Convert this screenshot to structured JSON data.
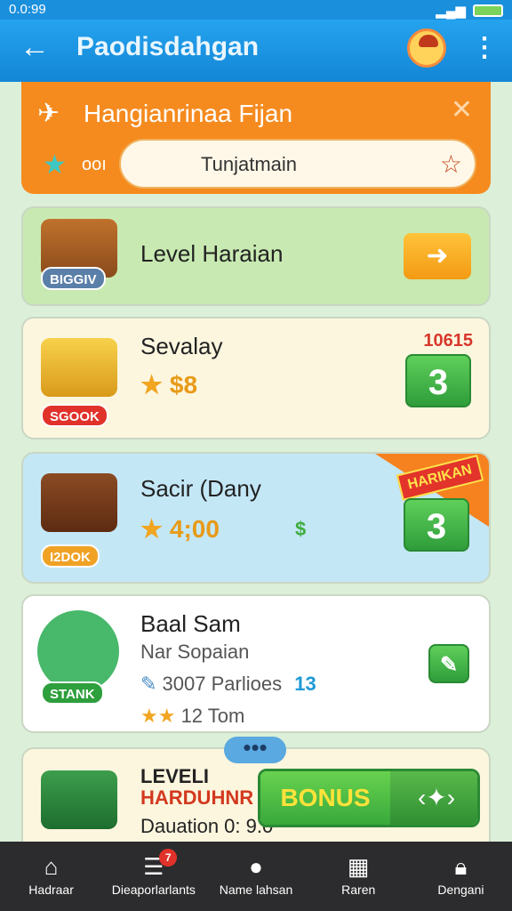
{
  "status_bar": {
    "time": "0.0:99"
  },
  "app_bar": {
    "title": "Paodisdahgan",
    "back_icon": "arrow-left-icon",
    "menu_icon": "more-vert-icon"
  },
  "banner": {
    "title": "Hangianrinaa Fijan",
    "label": "ooı",
    "field_value": "Tunjatmain"
  },
  "cards": [
    {
      "title": "Level Haraian",
      "tag": "BIGGIV"
    },
    {
      "title": "Sevalay",
      "price": "$8",
      "count": "10615",
      "badge": "3",
      "tag": "SGOOK"
    },
    {
      "title": "Sacir (Dany",
      "price": "4;00",
      "badge": "3",
      "tag": "I2DOK",
      "ribbon": "HARIKAN"
    },
    {
      "title": "Baal Sam",
      "subtitle": "Nar Sopaian",
      "info": "3007 Parlioes",
      "info_count": "13",
      "footer": "12 Tom",
      "tag": "STANK"
    },
    {
      "line1": "LEVELI",
      "line2": "HARDUHNR",
      "line3": "Dauation 0: 9.0"
    }
  ],
  "bonus": {
    "label": "BONUS"
  },
  "bottom_nav": [
    {
      "label": "Hadraar",
      "icon": "home-icon"
    },
    {
      "label": "Dieaporlarlants",
      "icon": "list-icon",
      "badge": "7"
    },
    {
      "label": "Name lahsan",
      "icon": "lightbulb-icon"
    },
    {
      "label": "Raren",
      "icon": "map-icon"
    },
    {
      "label": "Dengani",
      "icon": "lock-icon"
    }
  ],
  "colors": {
    "primary": "#1a8fdc",
    "banner": "#f58b1f",
    "green": "#3fae3f",
    "nav": "#2c2c2e"
  }
}
